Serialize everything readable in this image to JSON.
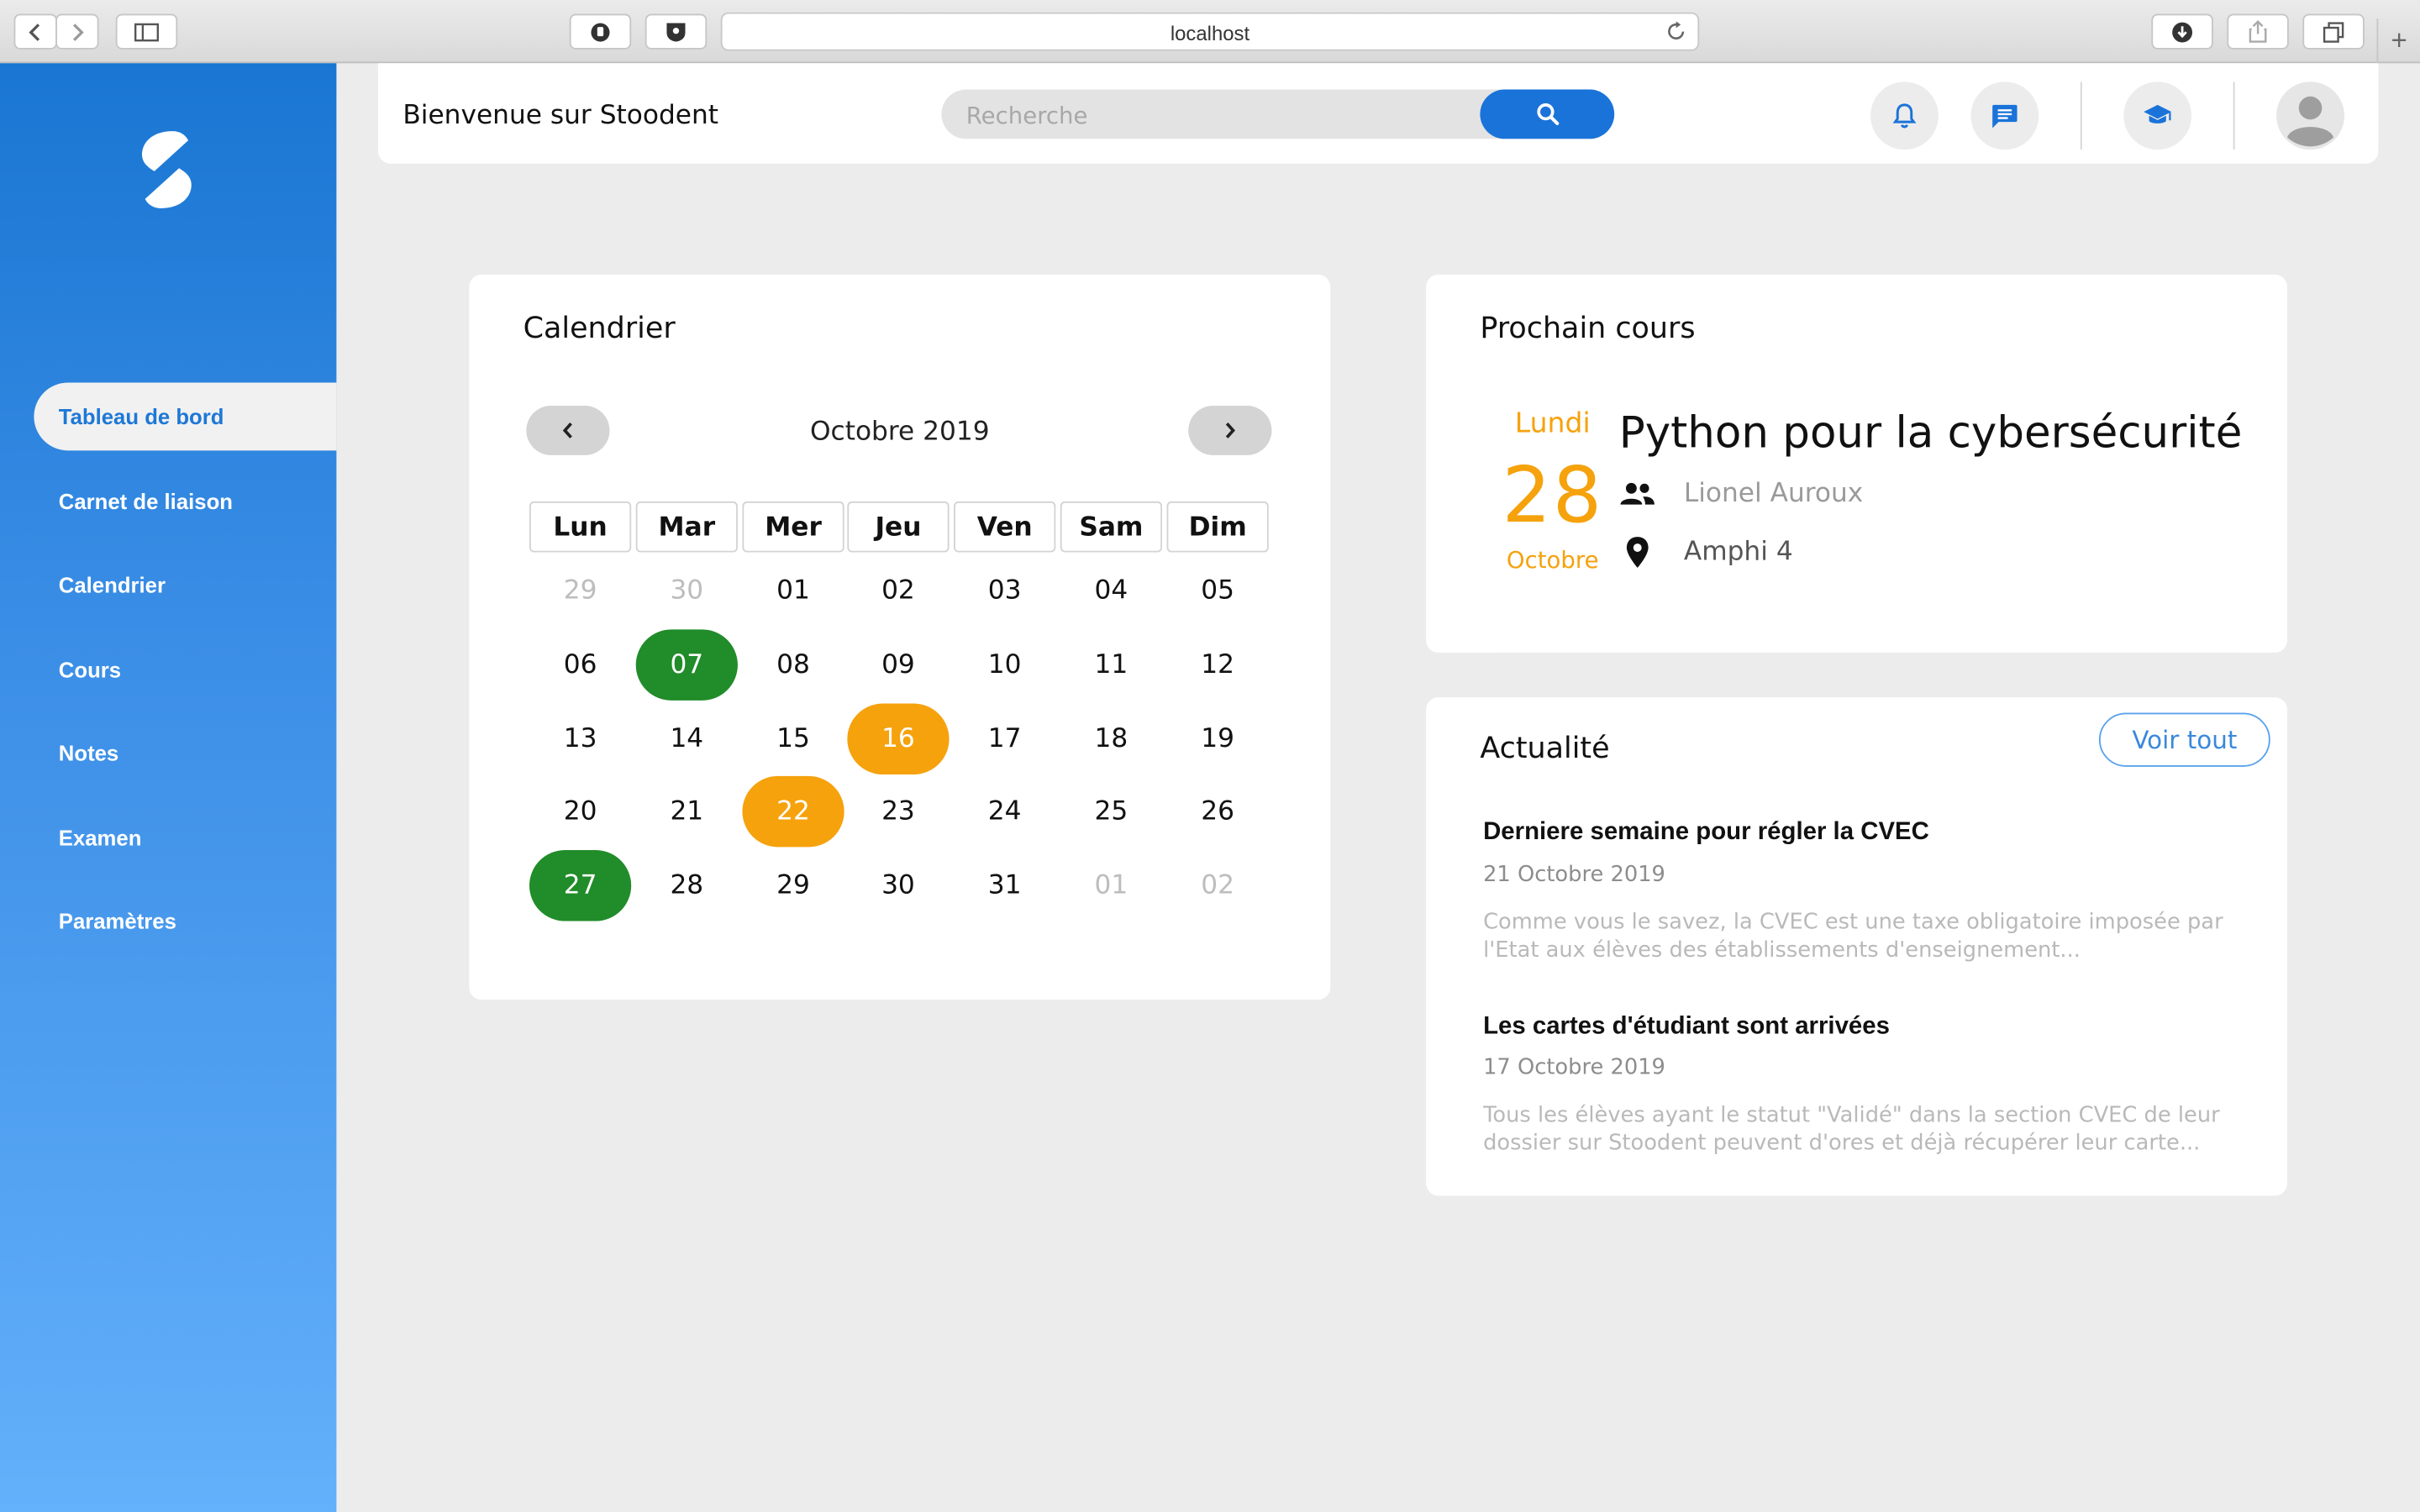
{
  "browser": {
    "url": "localhost"
  },
  "sidebar": {
    "items": [
      {
        "label": "Tableau de bord"
      },
      {
        "label": "Carnet de liaison"
      },
      {
        "label": "Calendrier"
      },
      {
        "label": "Cours"
      },
      {
        "label": "Notes"
      },
      {
        "label": "Examen"
      },
      {
        "label": "Paramètres"
      }
    ]
  },
  "header": {
    "welcome": "Bienvenue sur Stoodent",
    "search_placeholder": "Recherche"
  },
  "calendar": {
    "title": "Calendrier",
    "month": "Octobre 2019",
    "weekdays": [
      "Lun",
      "Mar",
      "Mer",
      "Jeu",
      "Ven",
      "Sam",
      "Dim"
    ],
    "days": [
      {
        "d": "29",
        "s": "muted"
      },
      {
        "d": "30",
        "s": "muted"
      },
      {
        "d": "01",
        "s": ""
      },
      {
        "d": "02",
        "s": ""
      },
      {
        "d": "03",
        "s": ""
      },
      {
        "d": "04",
        "s": ""
      },
      {
        "d": "05",
        "s": ""
      },
      {
        "d": "06",
        "s": ""
      },
      {
        "d": "07",
        "s": "green"
      },
      {
        "d": "08",
        "s": ""
      },
      {
        "d": "09",
        "s": ""
      },
      {
        "d": "10",
        "s": ""
      },
      {
        "d": "11",
        "s": ""
      },
      {
        "d": "12",
        "s": ""
      },
      {
        "d": "13",
        "s": ""
      },
      {
        "d": "14",
        "s": ""
      },
      {
        "d": "15",
        "s": ""
      },
      {
        "d": "16",
        "s": "orange"
      },
      {
        "d": "17",
        "s": ""
      },
      {
        "d": "18",
        "s": ""
      },
      {
        "d": "19",
        "s": ""
      },
      {
        "d": "20",
        "s": ""
      },
      {
        "d": "21",
        "s": ""
      },
      {
        "d": "22",
        "s": "orange"
      },
      {
        "d": "23",
        "s": ""
      },
      {
        "d": "24",
        "s": ""
      },
      {
        "d": "25",
        "s": ""
      },
      {
        "d": "26",
        "s": ""
      },
      {
        "d": "27",
        "s": "green"
      },
      {
        "d": "28",
        "s": ""
      },
      {
        "d": "29",
        "s": ""
      },
      {
        "d": "30",
        "s": ""
      },
      {
        "d": "31",
        "s": ""
      },
      {
        "d": "01",
        "s": "muted"
      },
      {
        "d": "02",
        "s": "muted"
      }
    ]
  },
  "next_course": {
    "title": "Prochain cours",
    "weekday": "Lundi",
    "day": "28",
    "month": "Octobre",
    "course": "Python pour la cybersécurité",
    "teacher": "Lionel Auroux",
    "room": "Amphi 4"
  },
  "news": {
    "title": "Actualité",
    "see_all": "Voir tout",
    "items": [
      {
        "title": "Derniere semaine pour régler la CVEC",
        "date": "21 Octobre 2019",
        "body": "Comme vous le savez, la CVEC est une taxe obligatoire imposée par l'Etat aux élèves des établissements d'enseignement..."
      },
      {
        "title": "Les cartes d'étudiant sont arrivées",
        "date": "17 Octobre 2019",
        "body": "Tous les élèves ayant le statut \"Validé\" dans la section CVEC de leur dossier sur Stoodent peuvent d'ores et déjà récupérer leur carte..."
      }
    ]
  },
  "colors": {
    "primary": "#1a73d9",
    "green": "#218c2a",
    "orange": "#f5a20d"
  }
}
